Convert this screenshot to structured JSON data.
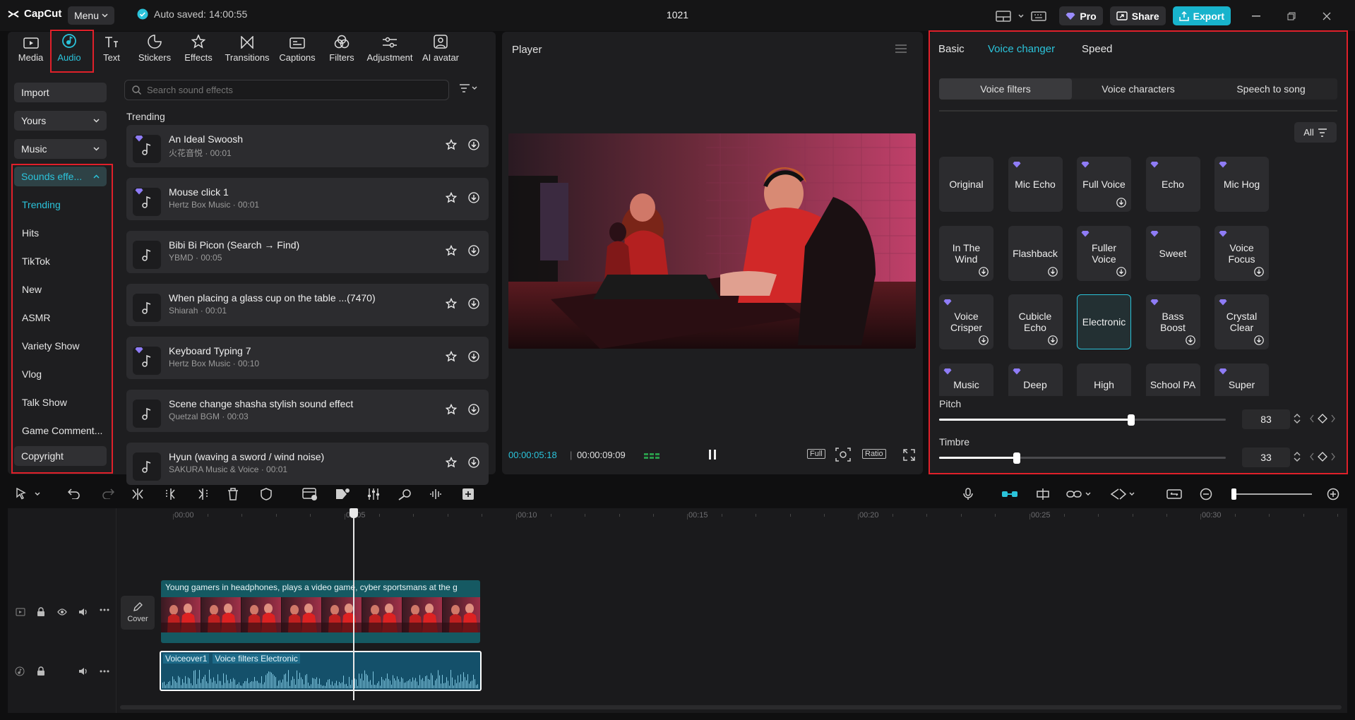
{
  "app": {
    "name": "CapCut",
    "menu_label": "Menu",
    "autosave": "Auto saved: 14:00:55",
    "project_title": "1021",
    "pro_label": "Pro",
    "share_label": "Share",
    "export_label": "Export"
  },
  "categories": [
    "Media",
    "Audio",
    "Text",
    "Stickers",
    "Effects",
    "Transitions",
    "Captions",
    "Filters",
    "Adjustment",
    "AI avatar"
  ],
  "active_category": "Audio",
  "sidebar": {
    "import": "Import",
    "yours": "Yours",
    "music": "Music",
    "sounds": "Sounds effe...",
    "items": [
      "Trending",
      "Hits",
      "TikTok",
      "New",
      "ASMR",
      "Variety Show",
      "Vlog",
      "Talk Show",
      "Game Comment...",
      "Copyright"
    ]
  },
  "search": {
    "placeholder": "Search sound effects"
  },
  "list_heading": "Trending",
  "sounds": [
    {
      "title": "An Ideal Swoosh",
      "meta": "火花音悦 · 00:01",
      "pro": true
    },
    {
      "title": "Mouse click 1",
      "meta": "Hertz Box Music · 00:01",
      "pro": true
    },
    {
      "title": "Bibi Bi Picon (Search → Find)",
      "meta": "YBMD · 00:05",
      "pro": false
    },
    {
      "title": "When placing a glass cup on the table ...(7470)",
      "meta": "Shiarah · 00:01",
      "pro": false
    },
    {
      "title": "Keyboard Typing 7",
      "meta": "Hertz Box Music · 00:10",
      "pro": true
    },
    {
      "title": "Scene change shasha stylish sound effect",
      "meta": "Quetzal BGM · 00:03",
      "pro": false
    },
    {
      "title": "Hyun (waving a sword / wind noise)",
      "meta": "SAKURA Music & Voice · 00:01",
      "pro": false
    }
  ],
  "player": {
    "title": "Player",
    "current_time": "00:00:05:18",
    "total_time": "00:00:09:09",
    "full_label": "Full",
    "ratio_label": "Ratio"
  },
  "right_tabs": [
    "Basic",
    "Voice changer",
    "Speed"
  ],
  "active_right_tab": "Voice changer",
  "segments": [
    "Voice filters",
    "Voice characters",
    "Speech to song"
  ],
  "active_segment": "Voice filters",
  "all_label": "All",
  "voice_filters": [
    {
      "name": "Original",
      "pro": false,
      "dl": false
    },
    {
      "name": "Mic Echo",
      "pro": true,
      "dl": false
    },
    {
      "name": "Full Voice",
      "pro": true,
      "dl": true
    },
    {
      "name": "Echo",
      "pro": true,
      "dl": false
    },
    {
      "name": "Mic Hog",
      "pro": true,
      "dl": false
    },
    {
      "name": "In The Wind",
      "pro": false,
      "dl": true
    },
    {
      "name": "Flashback",
      "pro": false,
      "dl": true
    },
    {
      "name": "Fuller Voice",
      "pro": true,
      "dl": true
    },
    {
      "name": "Sweet",
      "pro": true,
      "dl": false
    },
    {
      "name": "Voice Focus",
      "pro": true,
      "dl": true
    },
    {
      "name": "Voice Crisper",
      "pro": true,
      "dl": true
    },
    {
      "name": "Cubicle Echo",
      "pro": false,
      "dl": true
    },
    {
      "name": "Electronic",
      "pro": false,
      "dl": false,
      "selected": true
    },
    {
      "name": "Bass Boost",
      "pro": true,
      "dl": true
    },
    {
      "name": "Crystal Clear",
      "pro": true,
      "dl": true
    },
    {
      "name": "Music",
      "pro": true,
      "dl": false
    },
    {
      "name": "Deep",
      "pro": true,
      "dl": false
    },
    {
      "name": "High",
      "pro": false,
      "dl": false
    },
    {
      "name": "School PA",
      "pro": false,
      "dl": false
    },
    {
      "name": "Super",
      "pro": true,
      "dl": false
    }
  ],
  "sliders": {
    "pitch_label": "Pitch",
    "pitch_value": "83",
    "pitch_level": 0.67,
    "timbre_label": "Timbre",
    "timbre_value": "33",
    "timbre_level": 0.27
  },
  "timeline": {
    "ruler": [
      "00:00",
      "00:05",
      "00:10",
      "00:15",
      "00:20",
      "00:25",
      "00:30"
    ],
    "cover_label": "Cover",
    "video_clip_label": "Young gamers in headphones, plays a video game, cyber sportsmans at the g",
    "audio_clip_name": "Voiceover1",
    "audio_clip_effect": "Voice filters Electronic"
  },
  "colors": {
    "accent": "#2bc3da",
    "highlight_box": "#e0202a",
    "pro_gem": "#8f7cf7"
  }
}
